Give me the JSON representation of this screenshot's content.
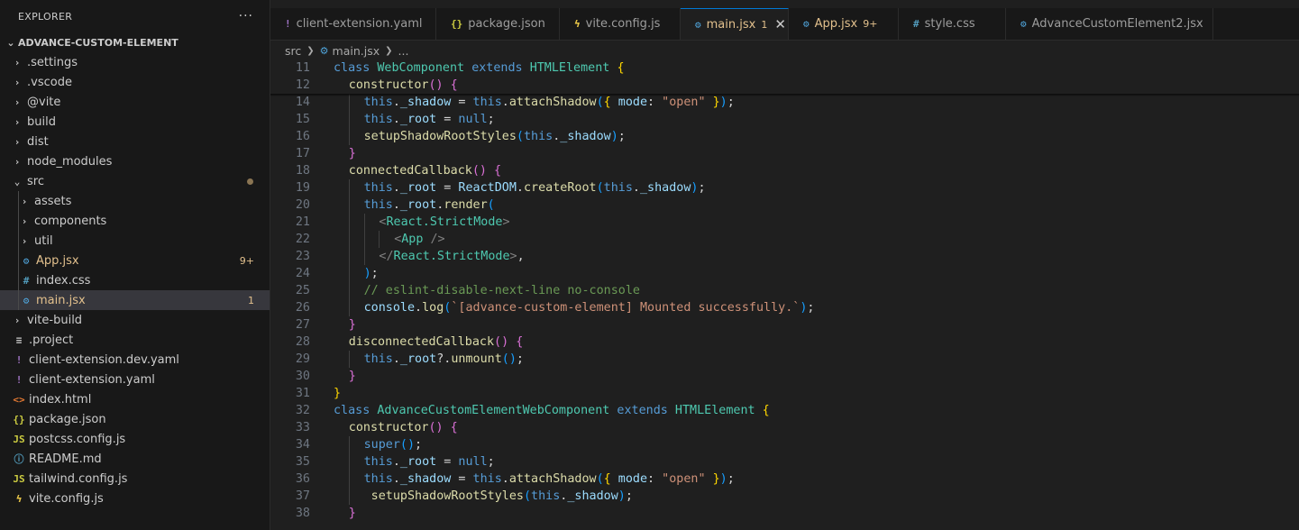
{
  "explorer": {
    "title": "EXPLORER",
    "more_label": "···",
    "project_name": "ADVANCE-CUSTOM-ELEMENT",
    "items": [
      {
        "label": ".settings",
        "kind": "folder",
        "depth": 0
      },
      {
        "label": ".vscode",
        "kind": "folder",
        "depth": 0
      },
      {
        "label": "@vite",
        "kind": "folder",
        "depth": 0
      },
      {
        "label": "build",
        "kind": "folder",
        "depth": 0
      },
      {
        "label": "dist",
        "kind": "folder",
        "depth": 0
      },
      {
        "label": "node_modules",
        "kind": "folder",
        "depth": 0
      },
      {
        "label": "src",
        "kind": "folder-open",
        "depth": 0,
        "modified_dot": true
      },
      {
        "label": "assets",
        "kind": "folder",
        "depth": 1
      },
      {
        "label": "components",
        "kind": "folder",
        "depth": 1
      },
      {
        "label": "util",
        "kind": "folder",
        "depth": 1
      },
      {
        "label": "App.jsx",
        "kind": "react",
        "depth": 1,
        "badge": "9+",
        "color": "#e2c08d"
      },
      {
        "label": "index.css",
        "kind": "css",
        "depth": 1
      },
      {
        "label": "main.jsx",
        "kind": "react",
        "depth": 1,
        "badge": "1",
        "color": "#e2c08d",
        "active": true
      },
      {
        "label": "vite-build",
        "kind": "folder",
        "depth": 0
      },
      {
        "label": ".project",
        "kind": "lines",
        "depth": 0
      },
      {
        "label": "client-extension.dev.yaml",
        "kind": "yaml",
        "depth": 0
      },
      {
        "label": "client-extension.yaml",
        "kind": "yaml",
        "depth": 0
      },
      {
        "label": "index.html",
        "kind": "html",
        "depth": 0
      },
      {
        "label": "package.json",
        "kind": "json",
        "depth": 0
      },
      {
        "label": "postcss.config.js",
        "kind": "js",
        "depth": 0
      },
      {
        "label": "README.md",
        "kind": "info",
        "depth": 0
      },
      {
        "label": "tailwind.config.js",
        "kind": "js",
        "depth": 0
      },
      {
        "label": "vite.config.js",
        "kind": "vite",
        "depth": 0
      }
    ]
  },
  "tabs": [
    {
      "label": "client-extension.yaml",
      "kind": "yaml",
      "width": 184
    },
    {
      "label": "package.json",
      "kind": "json",
      "width": 137
    },
    {
      "label": "vite.config.js",
      "kind": "vite",
      "width": 134
    },
    {
      "label": "main.jsx",
      "kind": "react",
      "badge": "1",
      "active": true,
      "color": "#e2c08d",
      "width": 120
    },
    {
      "label": "App.jsx",
      "kind": "react",
      "badge": "9+",
      "color": "#e2c08d",
      "width": 122
    },
    {
      "label": "style.css",
      "kind": "css",
      "width": 119
    },
    {
      "label": "AdvanceCustomElement2.jsx",
      "kind": "react",
      "width": 230
    }
  ],
  "breadcrumb": {
    "root": "src",
    "file": "main.jsx",
    "more": "..."
  },
  "editor": {
    "lines": [
      {
        "n": "11",
        "indent": 0,
        "sticky": true,
        "t": [
          [
            "kw",
            "class "
          ],
          [
            "cls",
            "WebComponent "
          ],
          [
            "kw",
            "extends "
          ],
          [
            "cls",
            "HTMLElement "
          ],
          [
            "br1",
            "{"
          ]
        ]
      },
      {
        "n": "12",
        "indent": 1,
        "sticky": true,
        "t": [
          [
            "fn",
            "constructor"
          ],
          [
            "br2",
            "() {"
          ]
        ]
      },
      {
        "n": "14",
        "indent": 2,
        "t": [
          [
            "kw",
            "this"
          ],
          [
            "pl",
            "."
          ],
          [
            "var",
            "_shadow"
          ],
          [
            "pl",
            " = "
          ],
          [
            "kw",
            "this"
          ],
          [
            "pl",
            "."
          ],
          [
            "fn",
            "attachShadow"
          ],
          [
            "br3",
            "("
          ],
          [
            "br1",
            "{ "
          ],
          [
            "var",
            "mode"
          ],
          [
            "pl",
            ": "
          ],
          [
            "str",
            "\"open\""
          ],
          [
            "br1",
            " }"
          ],
          [
            "br3",
            ")"
          ],
          [
            "pl",
            ";"
          ]
        ]
      },
      {
        "n": "15",
        "indent": 2,
        "t": [
          [
            "kw",
            "this"
          ],
          [
            "pl",
            "."
          ],
          [
            "var",
            "_root"
          ],
          [
            "pl",
            " = "
          ],
          [
            "kw",
            "null"
          ],
          [
            "pl",
            ";"
          ]
        ]
      },
      {
        "n": "16",
        "indent": 2,
        "t": [
          [
            "fn",
            "setupShadowRootStyles"
          ],
          [
            "br3",
            "("
          ],
          [
            "kw",
            "this"
          ],
          [
            "pl",
            "."
          ],
          [
            "var",
            "_shadow"
          ],
          [
            "br3",
            ")"
          ],
          [
            "pl",
            ";"
          ]
        ]
      },
      {
        "n": "17",
        "indent": 1,
        "t": [
          [
            "br2",
            "}"
          ]
        ]
      },
      {
        "n": "18",
        "indent": 1,
        "t": [
          [
            "fn",
            "connectedCallback"
          ],
          [
            "br2",
            "() {"
          ]
        ]
      },
      {
        "n": "19",
        "indent": 2,
        "t": [
          [
            "kw",
            "this"
          ],
          [
            "pl",
            "."
          ],
          [
            "var",
            "_root"
          ],
          [
            "pl",
            " = "
          ],
          [
            "var",
            "ReactDOM"
          ],
          [
            "pl",
            "."
          ],
          [
            "fn",
            "createRoot"
          ],
          [
            "br3",
            "("
          ],
          [
            "kw",
            "this"
          ],
          [
            "pl",
            "."
          ],
          [
            "var",
            "_shadow"
          ],
          [
            "br3",
            ")"
          ],
          [
            "pl",
            ";"
          ]
        ]
      },
      {
        "n": "20",
        "indent": 2,
        "t": [
          [
            "kw",
            "this"
          ],
          [
            "pl",
            "."
          ],
          [
            "var",
            "_root"
          ],
          [
            "pl",
            "."
          ],
          [
            "fn",
            "render"
          ],
          [
            "br3",
            "("
          ]
        ]
      },
      {
        "n": "21",
        "indent": 3,
        "t": [
          [
            "tagb",
            "<"
          ],
          [
            "tagn",
            "React.StrictMode"
          ],
          [
            "tagb",
            ">"
          ]
        ]
      },
      {
        "n": "22",
        "indent": 4,
        "t": [
          [
            "tagb",
            "<"
          ],
          [
            "tagn",
            "App "
          ],
          [
            "tagb",
            "/>"
          ]
        ]
      },
      {
        "n": "23",
        "indent": 3,
        "t": [
          [
            "tagb",
            "</"
          ],
          [
            "tagn",
            "React.StrictMode"
          ],
          [
            "tagb",
            ">"
          ],
          [
            "pl",
            ","
          ]
        ]
      },
      {
        "n": "24",
        "indent": 2,
        "t": [
          [
            "br3",
            ")"
          ],
          [
            "pl",
            ";"
          ]
        ]
      },
      {
        "n": "25",
        "indent": 2,
        "t": [
          [
            "cm",
            "// eslint-disable-next-line no-console"
          ]
        ]
      },
      {
        "n": "26",
        "indent": 2,
        "t": [
          [
            "var",
            "console"
          ],
          [
            "pl",
            "."
          ],
          [
            "fn",
            "log"
          ],
          [
            "br3",
            "("
          ],
          [
            "str",
            "`[advance-custom-element] Mounted successfully.`"
          ],
          [
            "br3",
            ")"
          ],
          [
            "pl",
            ";"
          ]
        ]
      },
      {
        "n": "27",
        "indent": 1,
        "t": [
          [
            "br2",
            "}"
          ]
        ]
      },
      {
        "n": "28",
        "indent": 1,
        "t": [
          [
            "fn",
            "disconnectedCallback"
          ],
          [
            "br2",
            "() {"
          ]
        ]
      },
      {
        "n": "29",
        "indent": 2,
        "t": [
          [
            "kw",
            "this"
          ],
          [
            "pl",
            "."
          ],
          [
            "var",
            "_root"
          ],
          [
            "pl",
            "?."
          ],
          [
            "fn",
            "unmount"
          ],
          [
            "br3",
            "()"
          ],
          [
            "pl",
            ";"
          ]
        ]
      },
      {
        "n": "30",
        "indent": 1,
        "t": [
          [
            "br2",
            "}"
          ]
        ]
      },
      {
        "n": "31",
        "indent": 0,
        "t": [
          [
            "br1",
            "}"
          ]
        ]
      },
      {
        "n": "32",
        "indent": 0,
        "t": [
          [
            "kw",
            "class "
          ],
          [
            "cls",
            "AdvanceCustomElementWebComponent "
          ],
          [
            "kw",
            "extends "
          ],
          [
            "cls",
            "HTMLElement "
          ],
          [
            "br1",
            "{"
          ]
        ]
      },
      {
        "n": "33",
        "indent": 1,
        "t": [
          [
            "fn",
            "constructor"
          ],
          [
            "br2",
            "() {"
          ]
        ]
      },
      {
        "n": "34",
        "indent": 2,
        "t": [
          [
            "kw",
            "super"
          ],
          [
            "br3",
            "()"
          ],
          [
            "pl",
            ";"
          ]
        ]
      },
      {
        "n": "35",
        "indent": 2,
        "t": [
          [
            "kw",
            "this"
          ],
          [
            "pl",
            "."
          ],
          [
            "var",
            "_root"
          ],
          [
            "pl",
            " = "
          ],
          [
            "kw",
            "null"
          ],
          [
            "pl",
            ";"
          ]
        ]
      },
      {
        "n": "36",
        "indent": 2,
        "t": [
          [
            "kw",
            "this"
          ],
          [
            "pl",
            "."
          ],
          [
            "var",
            "_shadow"
          ],
          [
            "pl",
            " = "
          ],
          [
            "kw",
            "this"
          ],
          [
            "pl",
            "."
          ],
          [
            "fn",
            "attachShadow"
          ],
          [
            "br3",
            "("
          ],
          [
            "br1",
            "{ "
          ],
          [
            "var",
            "mode"
          ],
          [
            "pl",
            ": "
          ],
          [
            "str",
            "\"open\""
          ],
          [
            "br1",
            " }"
          ],
          [
            "br3",
            ")"
          ],
          [
            "pl",
            ";"
          ]
        ]
      },
      {
        "n": "37",
        "indent": 2,
        "t": [
          [
            "pl",
            " "
          ],
          [
            "fn",
            "setupShadowRootStyles"
          ],
          [
            "br3",
            "("
          ],
          [
            "kw",
            "this"
          ],
          [
            "pl",
            "."
          ],
          [
            "var",
            "_shadow"
          ],
          [
            "br3",
            ")"
          ],
          [
            "pl",
            ";"
          ]
        ]
      },
      {
        "n": "38",
        "indent": 1,
        "t": [
          [
            "br2",
            "}"
          ]
        ]
      }
    ]
  }
}
